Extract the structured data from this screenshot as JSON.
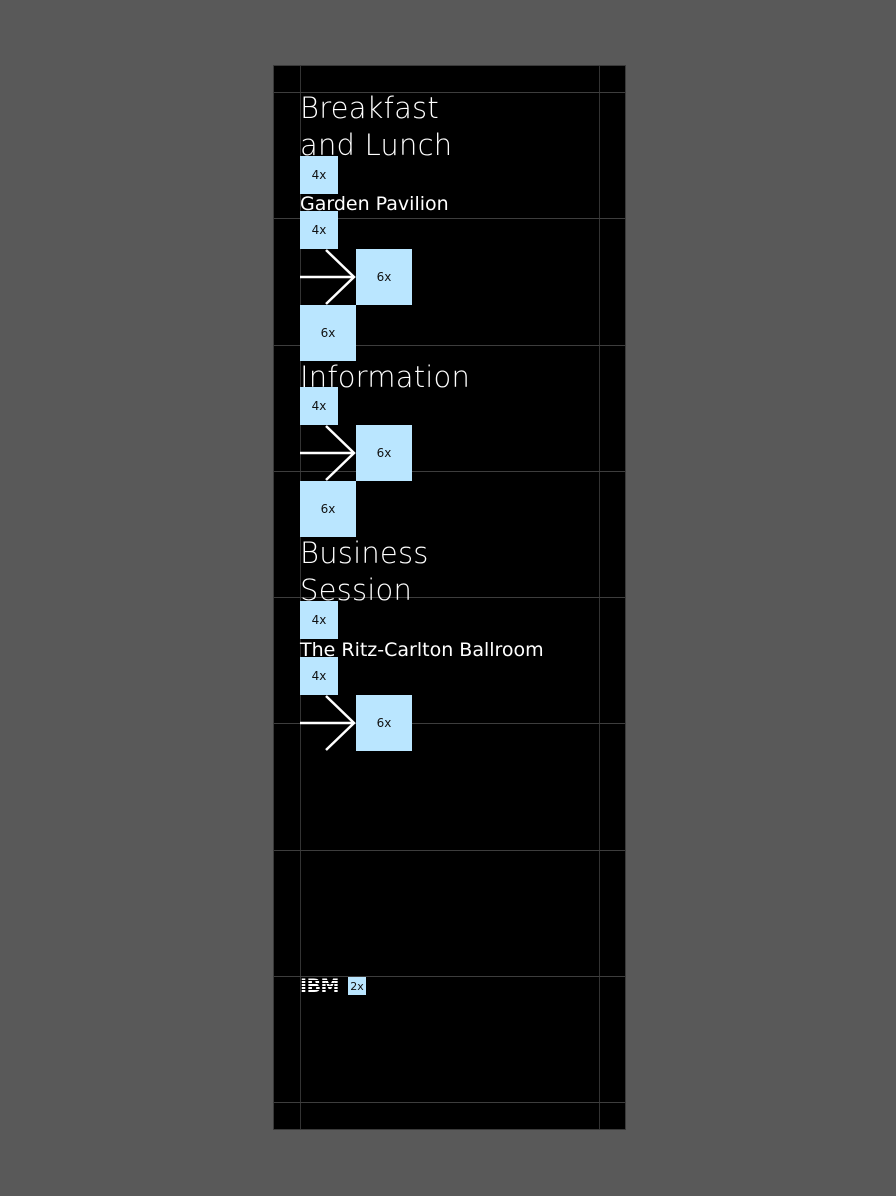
{
  "sections": [
    {
      "title": "Breakfast\nand Lunch",
      "subtitle": "Garden Pavilion"
    },
    {
      "title": "Information"
    },
    {
      "title": "Business\nSession",
      "subtitle": "The Ritz-Carlton Ballroom"
    }
  ],
  "spacing_tags": {
    "s4": "4x",
    "s6": "6x",
    "s2": "2x"
  },
  "logo": {
    "text": "IBM"
  },
  "colors": {
    "background": "#000000",
    "canvas": "#595959",
    "spacer": "#bae6ff",
    "text": "#ffffff"
  }
}
